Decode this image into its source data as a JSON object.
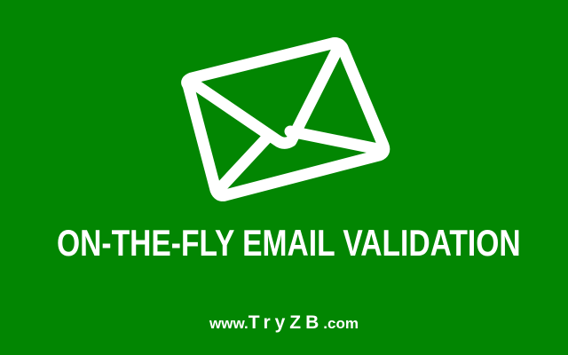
{
  "banner": {
    "icon": "envelope-icon",
    "title": "ON-THE-FLY EMAIL VALIDATION",
    "site_prefix": "www.",
    "site_brand": "TryZB",
    "site_suffix": ".com"
  },
  "colors": {
    "background": "#028602",
    "foreground": "#ffffff"
  }
}
